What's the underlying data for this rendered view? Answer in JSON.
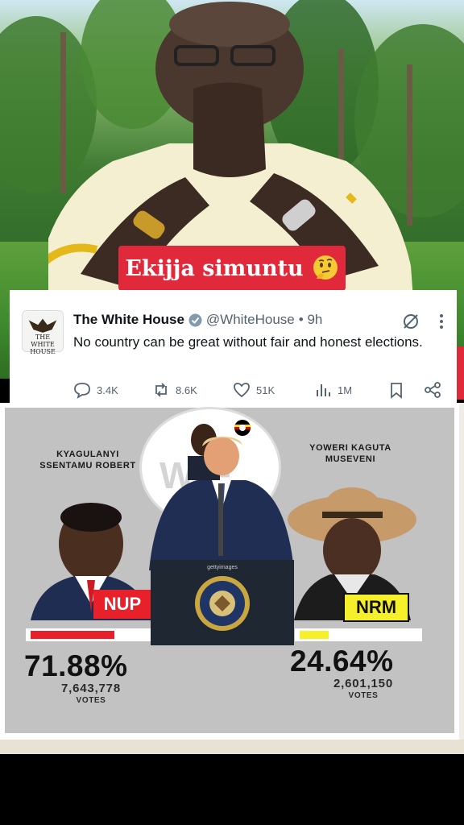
{
  "video": {
    "caption": "Ekijja simuntu"
  },
  "tweet": {
    "avatar_label": "THE WHITE HOUSE",
    "name": "The White House",
    "handle": "@WhiteHouse",
    "time": "• 9h",
    "text": "No country can be great without fair and honest elections.",
    "replies": "3.4K",
    "reposts": "8.6K",
    "likes": "51K",
    "views": "1M"
  },
  "graphic": {
    "left": {
      "name_line1": "KYAGULANYI",
      "name_line2": "SSENTAMU ROBERT",
      "party": "NUP",
      "percent_label": "71.88%",
      "percent": 71.88,
      "votes": "7,643,778",
      "votes_label": "VOTES"
    },
    "right": {
      "name_line1": "YOWERI KAGUTA",
      "name_line2": "MUSEVENI",
      "party": "NRM",
      "percent_label": "24.64%",
      "percent": 24.64,
      "votes": "2,601,150",
      "votes_label": "VOTES"
    },
    "podium_watermark": "gettyimages",
    "colors": {
      "nup": "#e8202a",
      "nrm": "#f5f02a"
    }
  }
}
